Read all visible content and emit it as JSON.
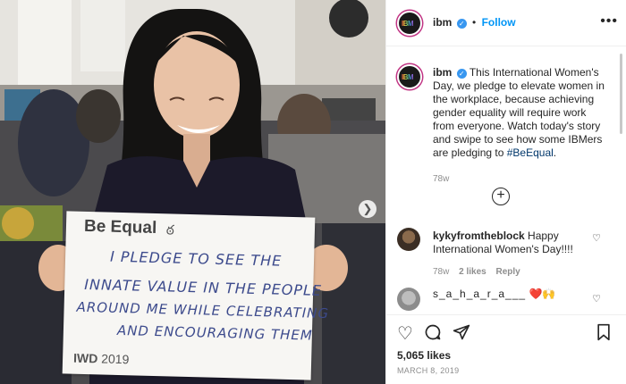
{
  "header": {
    "username": "ibm",
    "follow_label": "Follow",
    "separator": "•",
    "avatar_text": "IBM"
  },
  "caption": {
    "username": "ibm",
    "text": "This International Women's Day, we pledge to elevate women in the workplace, because achieving gender equality will require work from everyone. Watch today's story and swipe to see how some IBMers are pledging to ",
    "hashtag": "#BeEqual",
    "after": ".",
    "age": "78w"
  },
  "comments": [
    {
      "username": "kykyfromtheblock",
      "text": "Happy International Women's Day!!!!",
      "age": "78w",
      "likes": "2 likes",
      "reply_label": "Reply"
    },
    {
      "username": "s_a_h_a_r_a___",
      "emoji": "❤️🙌"
    }
  ],
  "sign": {
    "title": "Be Equal",
    "lines": [
      "I PLEDGE TO SEE THE",
      "INNATE VALUE IN THE PEOPLE",
      "AROUND ME WHILE CELEBRATING",
      "AND ENCOURAGING THEM"
    ],
    "footer_bold": "IWD",
    "footer_year": "2019"
  },
  "stats": {
    "likes": "5,065 likes",
    "date": "MARCH 8, 2019"
  },
  "icons": {
    "heart": "heart-icon",
    "comment": "comment-icon",
    "share": "share-icon",
    "save": "bookmark-icon",
    "more": "more-options-icon",
    "add_comment": "plus-circle-icon",
    "next": "chevron-right-icon",
    "verified": "verified-badge-icon"
  },
  "colors": {
    "follow": "#0095f6",
    "verified": "#3897f0",
    "hashtag": "#00376b",
    "meta_gray": "#8e8e8e"
  }
}
